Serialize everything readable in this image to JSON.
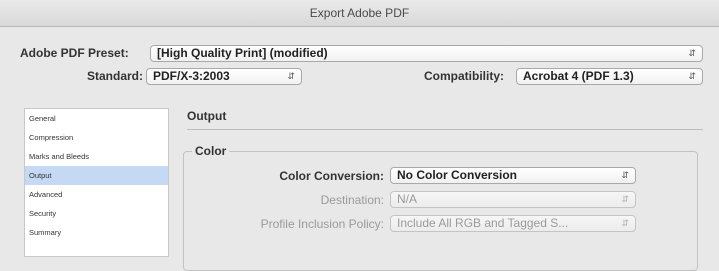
{
  "window": {
    "title": "Export Adobe PDF"
  },
  "preset": {
    "label": "Adobe PDF Preset:",
    "value": "[High Quality Print] (modified)"
  },
  "standard": {
    "label": "Standard:",
    "value": "PDF/X-3:2003"
  },
  "compatibility": {
    "label": "Compatibility:",
    "value": "Acrobat 4 (PDF 1.3)"
  },
  "sidebar": {
    "items": [
      {
        "label": "General"
      },
      {
        "label": "Compression"
      },
      {
        "label": "Marks and Bleeds"
      },
      {
        "label": "Output"
      },
      {
        "label": "Advanced"
      },
      {
        "label": "Security"
      },
      {
        "label": "Summary"
      }
    ],
    "selected": "Output"
  },
  "main": {
    "section_title": "Output",
    "color_group": {
      "legend": "Color",
      "color_conversion": {
        "label": "Color Conversion:",
        "value": "No Color Conversion"
      },
      "destination": {
        "label": "Destination:",
        "value": "N/A"
      },
      "profile_policy": {
        "label": "Profile Inclusion Policy:",
        "value": "Include All RGB and Tagged S..."
      }
    }
  },
  "icons": {
    "dropdown": "updown-arrows-icon"
  },
  "colors": {
    "selection": "#c6d9f4",
    "disabled_text": "#9a9a9a"
  }
}
